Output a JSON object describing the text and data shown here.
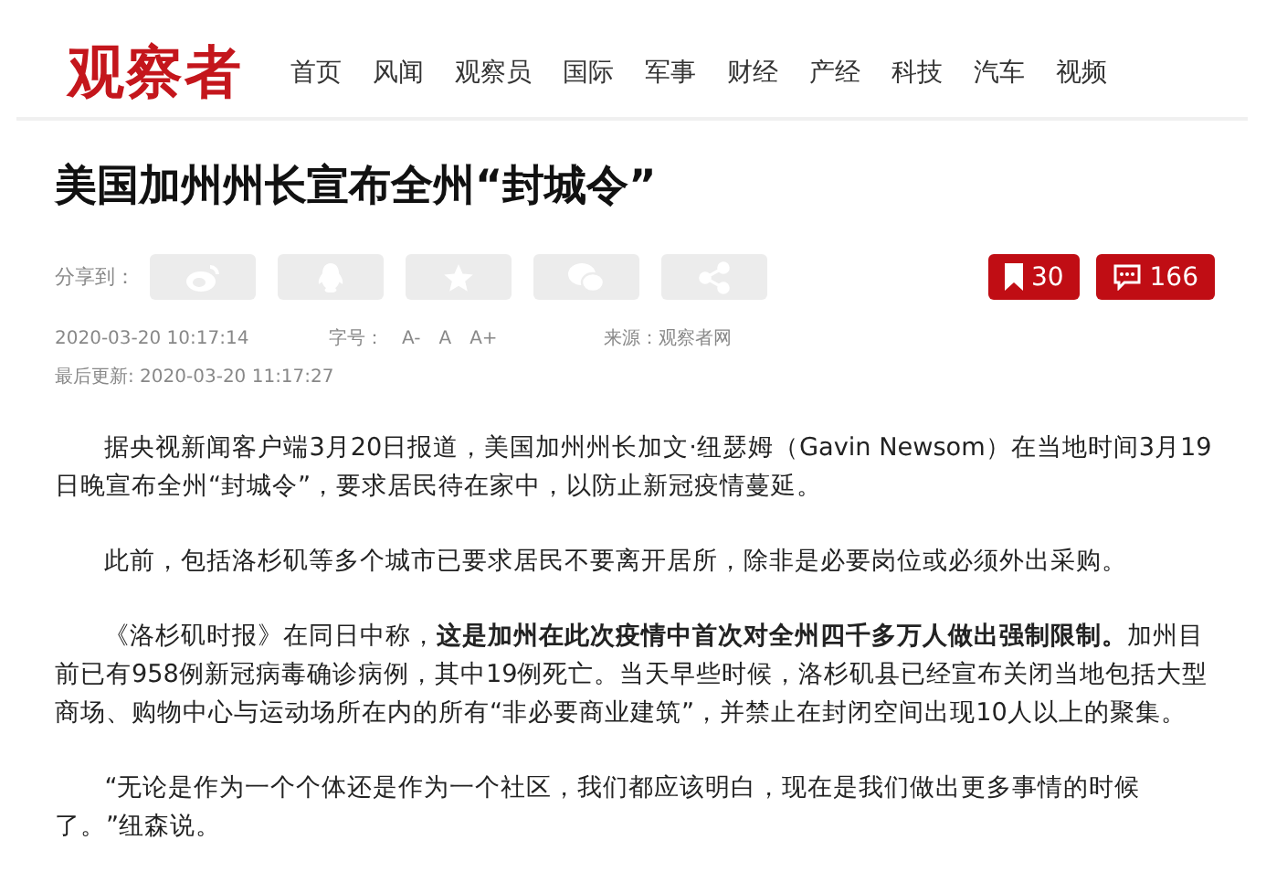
{
  "header": {
    "logo": "观察者",
    "nav": [
      "首页",
      "风闻",
      "观察员",
      "国际",
      "军事",
      "财经",
      "产经",
      "科技",
      "汽车",
      "视频"
    ]
  },
  "article": {
    "title": "美国加州州长宣布全州“封城令”",
    "share_label": "分享到：",
    "share_buttons": [
      {
        "kind": "swirl"
      },
      {
        "kind": "penguin"
      },
      {
        "kind": "star"
      },
      {
        "kind": "chat"
      },
      {
        "kind": "share"
      }
    ],
    "bookmark_count": "30",
    "comment_count": "166",
    "published": "2020-03-20 10:17:14",
    "font_label": "字号：",
    "font_sizes": [
      "A-",
      "A",
      "A+"
    ],
    "source": "来源：观察者网",
    "updated": "最后更新: 2020-03-20 11:17:27",
    "paragraphs": [
      "据央视新闻客户端3月20日报道，美国加州州长加文·纽瑟姆（Gavin Newsom）在当地时间3月19日晚宣布全州“封城令”，要求居民待在家中，以防止新冠疫情蔓延。",
      "此前，包括洛杉矶等多个城市已要求居民不要离开居所，除非是必要岗位或必须外出采购。",
      "《洛杉矶时报》在同日中称，**这是加州在此次疫情中首次对全州四千多万人做出强制限制。**加州目前已有958例新冠病毒确诊病例，其中19例死亡。当天早些时候，洛杉矶县已经宣布关闭当地包括大型商场、购物中心与运动场所在内的所有“非必要商业建筑”，并禁止在封闭空间出现10人以上的聚集。",
      "“无论是作为一个个体还是作为一个社区，我们都应该明白，现在是我们做出更多事情的时候了。”纽森说。"
    ]
  }
}
